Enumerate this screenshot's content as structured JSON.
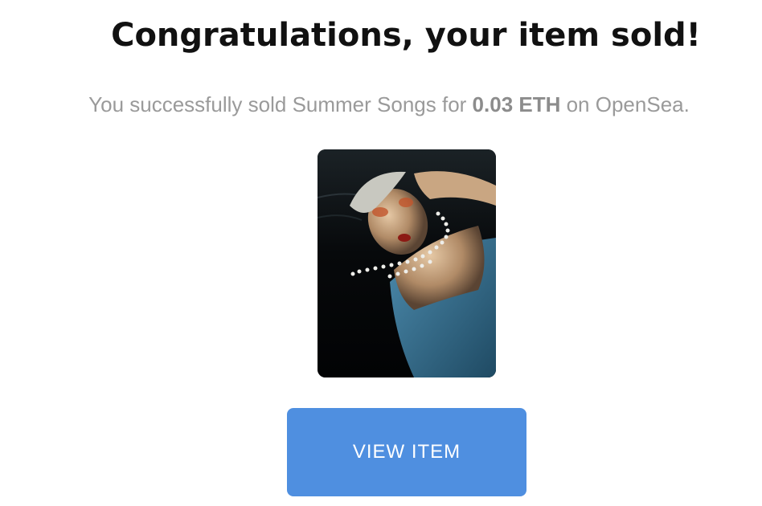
{
  "header": {
    "title": "Congratulations, your item sold!"
  },
  "message": {
    "prefix": "You successfully sold ",
    "item_name": "Summer Songs",
    "for_text": " for ",
    "price": "0.03 ETH",
    "suffix": " on OpenSea."
  },
  "item": {
    "image_subject": "portrait-photo"
  },
  "actions": {
    "view_item_label": "VIEW ITEM"
  },
  "colors": {
    "button": "#4f8fe0",
    "title_text": "#111111",
    "subtitle_text": "#9a9a9a"
  }
}
